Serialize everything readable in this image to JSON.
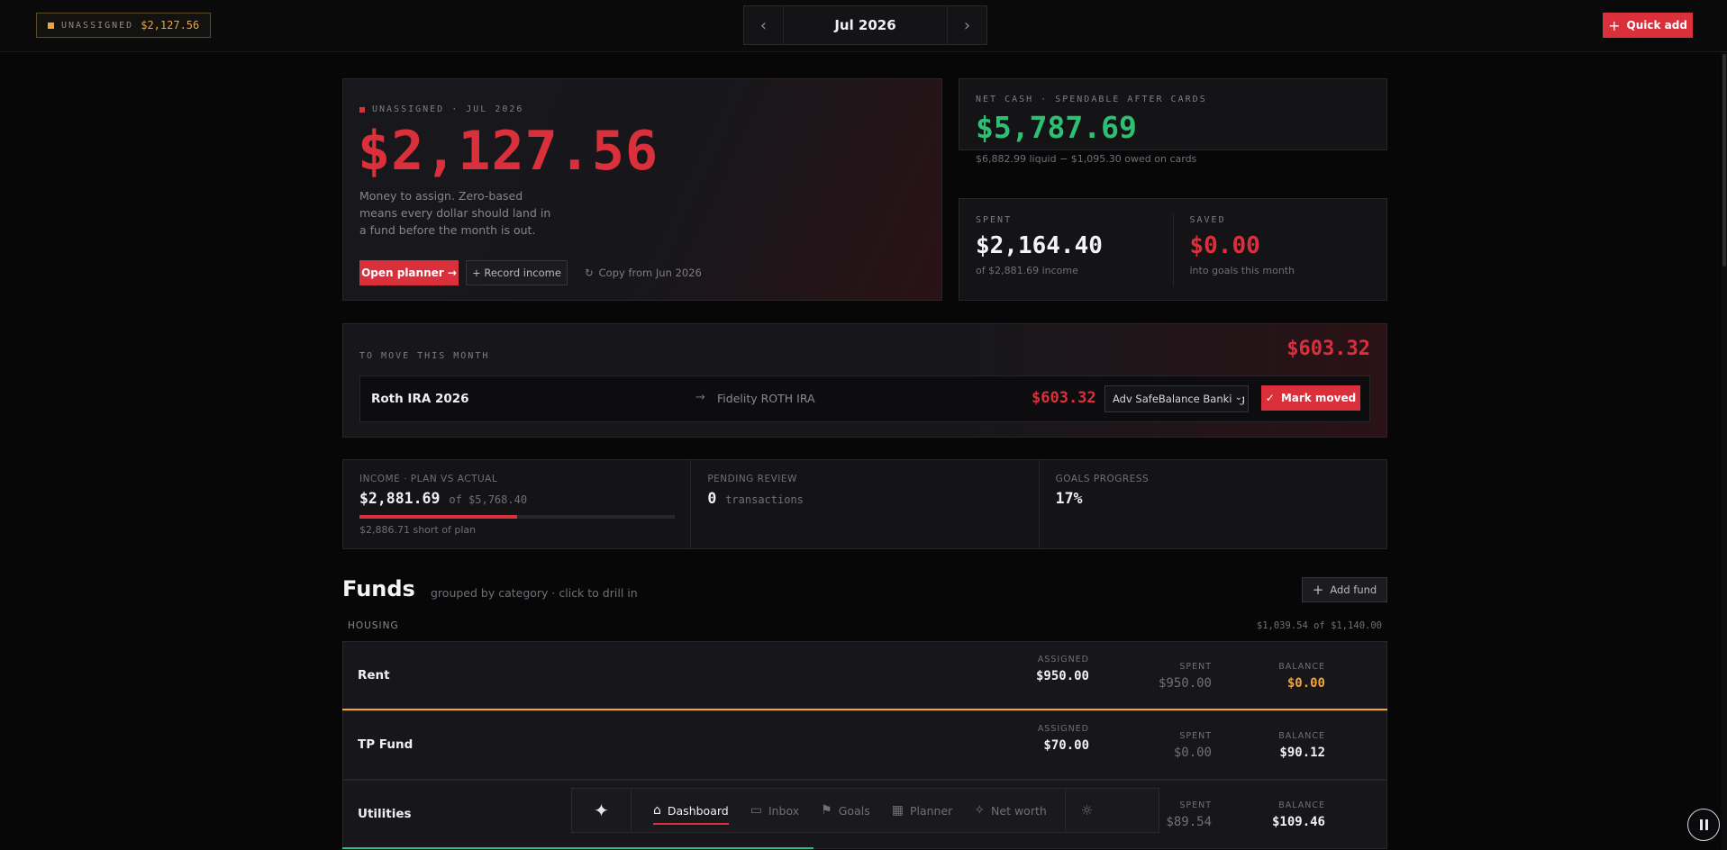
{
  "topbar": {
    "unassigned_label": "UNASSIGNED",
    "unassigned_value": "$2,127.56",
    "month": "Jul 2026",
    "quick_add": "Quick add"
  },
  "hero": {
    "eyebrow": "UNASSIGNED · JUL 2026",
    "amount": "$2,127.56",
    "description": "Money to assign. Zero-based means every dollar should land in a fund before the month is out.",
    "open_planner": "Open planner →",
    "record_income": "+ Record income",
    "copy_from": "Copy from Jun 2026"
  },
  "netcash": {
    "label": "NET CASH · SPENDABLE AFTER CARDS",
    "value": "$5,787.69",
    "sub": "$6,882.99 liquid − $1,095.30 owed on cards"
  },
  "spent": {
    "label": "SPENT",
    "value": "$2,164.40",
    "sub": "of $2,881.69 income"
  },
  "saved": {
    "label": "SAVED",
    "value": "$0.00",
    "sub": "into goals this month"
  },
  "tomove": {
    "label": "TO MOVE THIS MONTH",
    "total": "$603.32",
    "row": {
      "name": "Roth IRA 2026",
      "arrow": "→",
      "destination": "Fidelity ROTH IRA",
      "amount": "$603.32",
      "account": "Adv SafeBalance Banking",
      "mark_moved": "Mark moved"
    }
  },
  "stats": {
    "income": {
      "caption": "INCOME · PLAN VS ACTUAL",
      "value": "$2,881.69",
      "of": "of $5,768.40",
      "progress": 0.5,
      "sub": "$2,886.71 short of plan"
    },
    "pending": {
      "caption": "PENDING REVIEW",
      "value": "0",
      "unit": "transactions"
    },
    "goals": {
      "caption": "GOALS PROGRESS",
      "value": "17%"
    }
  },
  "funds": {
    "title": "Funds",
    "subtitle": "grouped by category · click to drill in",
    "add_fund": "Add fund",
    "category": {
      "name": "HOUSING",
      "total": "$1,039.54",
      "of": "of",
      "planned": "$1,140.00"
    },
    "col_assigned": "ASSIGNED",
    "col_spent": "SPENT",
    "col_balance": "BALANCE",
    "items": [
      {
        "name": "Rent",
        "assigned": "$950.00",
        "spent": "$950.00",
        "balance": "$0.00",
        "balance_color": "#f0a33a",
        "bar_color": "#f0a33a",
        "bar_fill": 1.0
      },
      {
        "name": "TP Fund",
        "assigned": "$70.00",
        "spent": "$0.00",
        "balance": "$90.12",
        "balance_color": "#f0f0f2"
      },
      {
        "name": "Utilities",
        "spent": "$89.54",
        "balance": "$109.46",
        "balance_color": "#f0f0f2",
        "bar_color": "#2fbf8f",
        "bar_fill": 0.45
      }
    ]
  },
  "nav": {
    "items": [
      {
        "label": "Dashboard",
        "icon": "home-icon"
      },
      {
        "label": "Inbox",
        "icon": "inbox-icon"
      },
      {
        "label": "Goals",
        "icon": "flag-icon"
      },
      {
        "label": "Planner",
        "icon": "calendar-icon"
      },
      {
        "label": "Net worth",
        "icon": "sparkle-icon"
      }
    ]
  },
  "colors": {
    "accent": "#d9303c",
    "positive": "#2fbf73",
    "warning": "#f0a33a"
  }
}
